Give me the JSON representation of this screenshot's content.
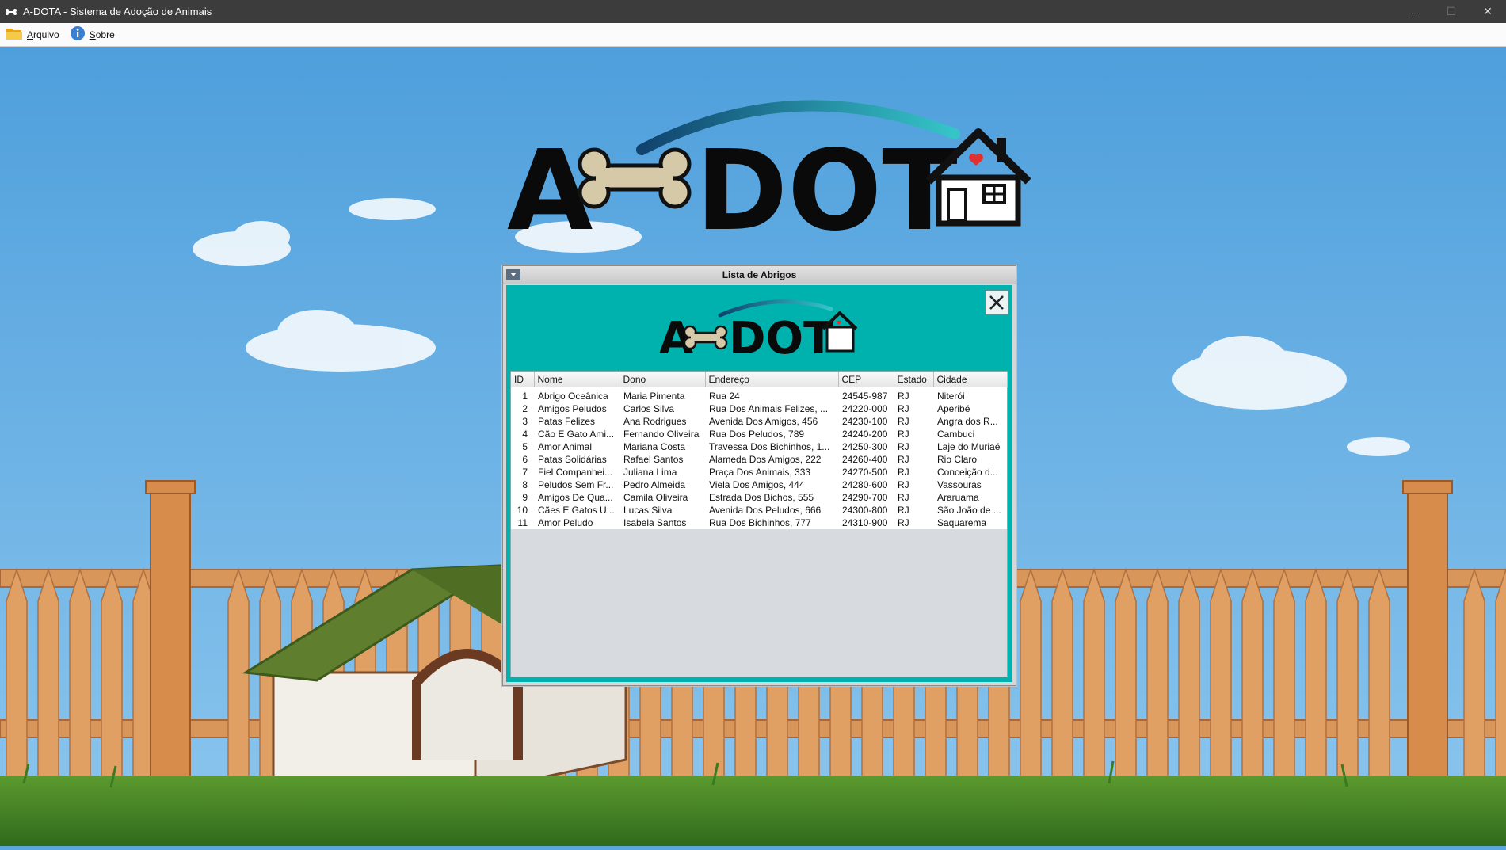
{
  "window": {
    "title": "A-DOTA - Sistema de Adoção de Animais",
    "minimize": "–",
    "maximize": "☐",
    "close": "✕"
  },
  "menu": {
    "items": [
      {
        "label": "Arquivo",
        "icon": "folder-icon"
      },
      {
        "label": "Sobre",
        "icon": "info-icon"
      }
    ]
  },
  "logo": {
    "text_left": "A",
    "text_right": "DOT",
    "alt": "A-DOTA logo"
  },
  "dialog": {
    "title": "Lista de Abrigos",
    "table": {
      "columns": [
        "ID",
        "Nome",
        "Dono",
        "Endereço",
        "CEP",
        "Estado",
        "Cidade"
      ],
      "rows": [
        [
          "1",
          "Abrigo Oceânica",
          "Maria Pimenta",
          "Rua 24",
          "24545-987",
          "RJ",
          "Niterói"
        ],
        [
          "2",
          "Amigos Peludos",
          "Carlos Silva",
          "Rua Dos Animais Felizes, ...",
          "24220-000",
          "RJ",
          "Aperibé"
        ],
        [
          "3",
          "Patas Felizes",
          "Ana Rodrigues",
          "Avenida Dos Amigos, 456",
          "24230-100",
          "RJ",
          "Angra dos R..."
        ],
        [
          "4",
          "Cão E Gato Ami...",
          "Fernando Oliveira",
          "Rua Dos Peludos, 789",
          "24240-200",
          "RJ",
          "Cambuci"
        ],
        [
          "5",
          "Amor Animal",
          "Mariana Costa",
          "Travessa Dos Bichinhos, 1...",
          "24250-300",
          "RJ",
          "Laje do Muriaé"
        ],
        [
          "6",
          "Patas Solidárias",
          "Rafael Santos",
          "Alameda Dos Amigos, 222",
          "24260-400",
          "RJ",
          "Rio Claro"
        ],
        [
          "7",
          "Fiel Companhei...",
          "Juliana Lima",
          "Praça Dos Animais, 333",
          "24270-500",
          "RJ",
          "Conceição d..."
        ],
        [
          "8",
          "Peludos Sem Fr...",
          "Pedro Almeida",
          "Viela Dos Amigos, 444",
          "24280-600",
          "RJ",
          "Vassouras"
        ],
        [
          "9",
          "Amigos De Qua...",
          "Camila Oliveira",
          "Estrada Dos Bichos, 555",
          "24290-700",
          "RJ",
          "Araruama"
        ],
        [
          "10",
          "Cães E Gatos U...",
          "Lucas Silva",
          "Avenida Dos Peludos, 666",
          "24300-800",
          "RJ",
          "São João de ..."
        ],
        [
          "11",
          "Amor Peludo",
          "Isabela Santos",
          "Rua Dos Bichinhos, 777",
          "24310-900",
          "RJ",
          "Saquarema"
        ]
      ]
    }
  },
  "colors": {
    "dialog_bg": "#00b2ae",
    "sky": "#5aa6de",
    "fence": "#d9965a",
    "grass": "#4f8c2a"
  }
}
